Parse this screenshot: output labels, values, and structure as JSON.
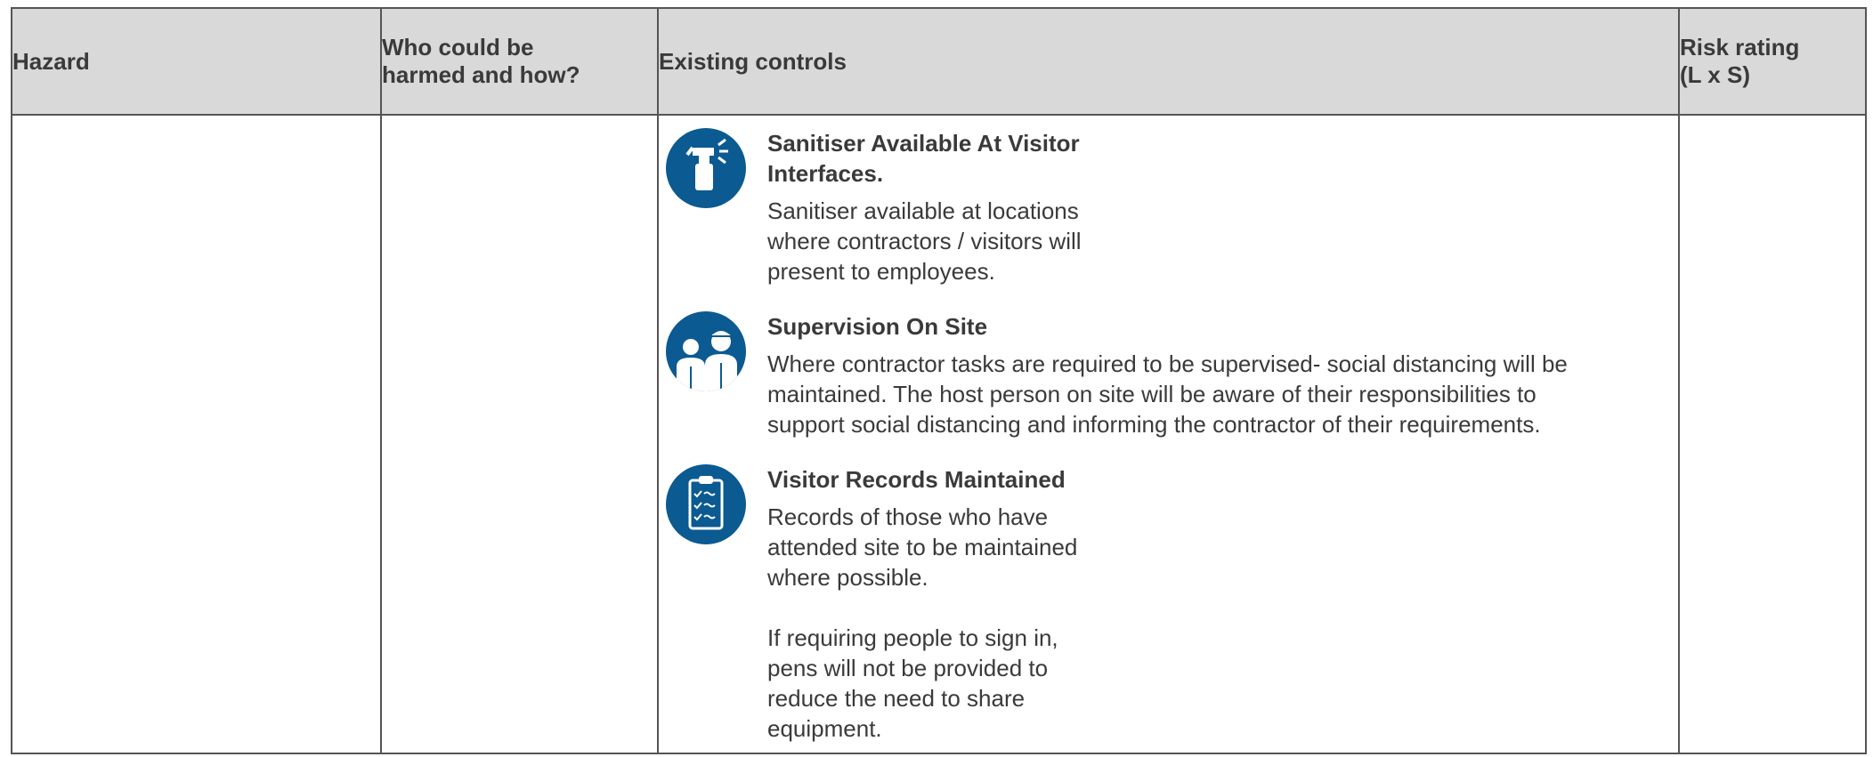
{
  "table": {
    "headers": {
      "hazard": "Hazard",
      "who_line1": "Who could be",
      "who_line2": "harmed and how?",
      "controls": "Existing controls",
      "risk_line1": "Risk rating",
      "risk_line2": "(L x S)"
    },
    "controls": [
      {
        "icon": "spray-bottle-icon",
        "title_line1": "Sanitiser Available At Visitor",
        "title_line2": "Interfaces.",
        "desc_lines": [
          "Sanitiser available at locations",
          "where contractors / visitors will",
          "present to employees."
        ]
      },
      {
        "icon": "supervisor-group-icon",
        "title_line1": "Supervision On Site",
        "desc_lines": [
          "Where contractor tasks are required to be supervised- social distancing will be",
          "maintained. The host person on site will be aware of their responsibilities to",
          "support social distancing and informing the contractor of their requirements."
        ]
      },
      {
        "icon": "clipboard-checklist-icon",
        "title_line1": "Visitor Records Maintained",
        "desc_lines": [
          "Records of those who have",
          "attended site to be maintained",
          "where possible."
        ],
        "desc2_lines": [
          "If requiring people to sign in,",
          "pens will not be provided to",
          "reduce the need to share",
          "equipment."
        ]
      }
    ]
  },
  "colors": {
    "icon_bg": "#0b5a91",
    "header_bg": "#d9d9d9",
    "text": "#3a3a3a",
    "border": "#555555"
  }
}
